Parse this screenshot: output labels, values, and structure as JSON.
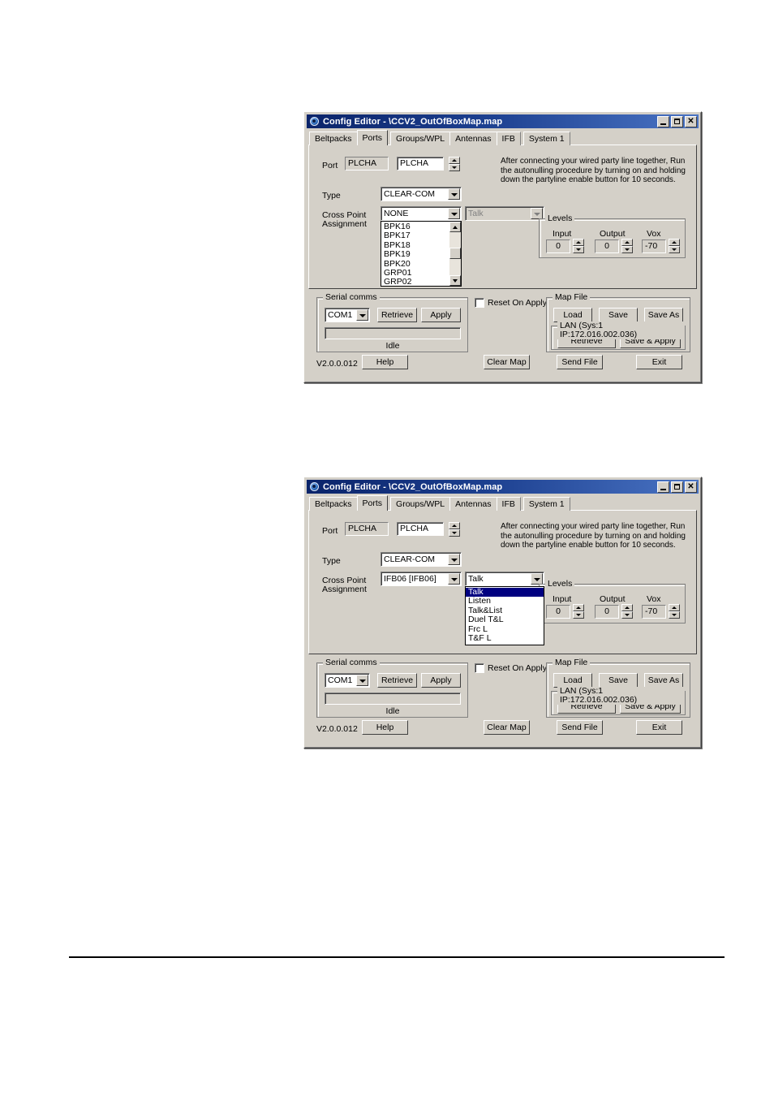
{
  "page": {
    "background": "#ffffff",
    "rule_color": "#000000"
  },
  "window": {
    "title": "Config Editor - \\CCV2_OutOfBoxMap.map",
    "icon": "config-editor-icon",
    "titlebar_color_left": "#0b246a",
    "titlebar_color_right": "#4a74c4",
    "buttons": {
      "minimize": "_",
      "maximize": "□",
      "close": "✕"
    },
    "tabs": [
      {
        "label": "Beltpacks",
        "selected": false
      },
      {
        "label": "Ports",
        "selected": true
      },
      {
        "label": "Groups/WPL",
        "selected": false
      },
      {
        "label": "Antennas",
        "selected": false
      },
      {
        "label": "IFB",
        "selected": false
      },
      {
        "label": "System 1",
        "selected": false
      }
    ],
    "ports_tab": {
      "port_label": "Port",
      "port_readonly_value": "PLCHA",
      "port_edit_value": "PLCHA",
      "type_label": "Type",
      "type_value": "CLEAR-COM",
      "crosspoint_label_line1": "Cross Point",
      "crosspoint_label_line2": "Assignment",
      "info_text": "After connecting your wired party line together, Run the autonulling procedure by turning on and holding down the partyline enable button for 10 seconds.",
      "levels": {
        "group_title": "Levels",
        "input_label": "Input",
        "input_value": "0",
        "output_label": "Output",
        "output_value": "0",
        "vox_label": "Vox",
        "vox_value": "-70"
      }
    },
    "serial_comms": {
      "group_title": "Serial comms",
      "port_value": "COM1",
      "retrieve_label": "Retrieve",
      "apply_label": "Apply",
      "progress_value": "",
      "status": "Idle"
    },
    "reset_on_apply": {
      "label": "Reset On Apply",
      "checked": false
    },
    "map_file": {
      "group_title": "Map File",
      "load_label": "Load",
      "save_label": "Save",
      "save_as_label": "Save As",
      "lan_group_title": "LAN  (Sys:1 IP:172.016.002.036)",
      "lan_retrieve_label": "Retrieve",
      "lan_save_apply_label": "Save & Apply"
    },
    "footer": {
      "version": "V2.0.0.012",
      "help_label": "Help",
      "clear_map_label": "Clear Map",
      "send_file_label": "Send File",
      "exit_label": "Exit"
    }
  },
  "screenshot_top": {
    "crosspoint_value": "NONE",
    "mode_value": "Talk",
    "mode_disabled": true,
    "open_list": {
      "items": [
        "BPK16",
        "BPK17",
        "BPK18",
        "BPK19",
        "BPK20",
        "GRP01",
        "GRP02"
      ],
      "selected_index": -1,
      "has_scrollbar": true,
      "scroll_thumb_position_pct": 46
    }
  },
  "screenshot_bottom": {
    "crosspoint_value": "IFB06  [IFB06]",
    "mode_value": "Talk",
    "mode_disabled": false,
    "open_list": {
      "items": [
        "Talk",
        "Listen",
        "Talk&List",
        "Duel T&L",
        "Frc L",
        "T&F L"
      ],
      "selected_index": 0,
      "has_scrollbar": false
    }
  }
}
